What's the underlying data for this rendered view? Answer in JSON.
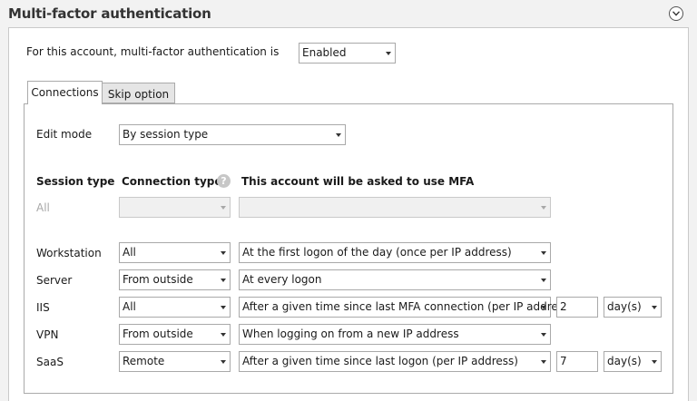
{
  "header": {
    "title": "Multi-factor authentication",
    "collapse_icon": "chevron-down-icon"
  },
  "account": {
    "label": "For this account, multi-factor authentication is",
    "status": "Enabled"
  },
  "tabs": [
    {
      "label": "Connections",
      "active": true
    },
    {
      "label": "Skip option",
      "active": false
    }
  ],
  "edit_mode": {
    "label": "Edit mode",
    "value": "By session type"
  },
  "columns": {
    "session_type": "Session type",
    "connection_types": "Connection types",
    "mfa": "This account will be asked to use MFA"
  },
  "rows": [
    {
      "session": "All",
      "connection": "",
      "mfa": "",
      "disabled": true
    },
    {
      "session": "Workstation",
      "connection": "All",
      "mfa": "At the first logon of the day (once per IP address)"
    },
    {
      "session": "Server",
      "connection": "From outside",
      "mfa": "At every logon"
    },
    {
      "session": "IIS",
      "connection": "All",
      "mfa": "After a given time since last MFA connection (per IP address)",
      "amount": "2",
      "unit": "day(s)"
    },
    {
      "session": "VPN",
      "connection": "From outside",
      "mfa": "When logging on from a new IP address"
    },
    {
      "session": "SaaS",
      "connection": "Remote",
      "mfa": "After a given time since last logon (per IP address)",
      "amount": "7",
      "unit": "day(s)"
    }
  ]
}
